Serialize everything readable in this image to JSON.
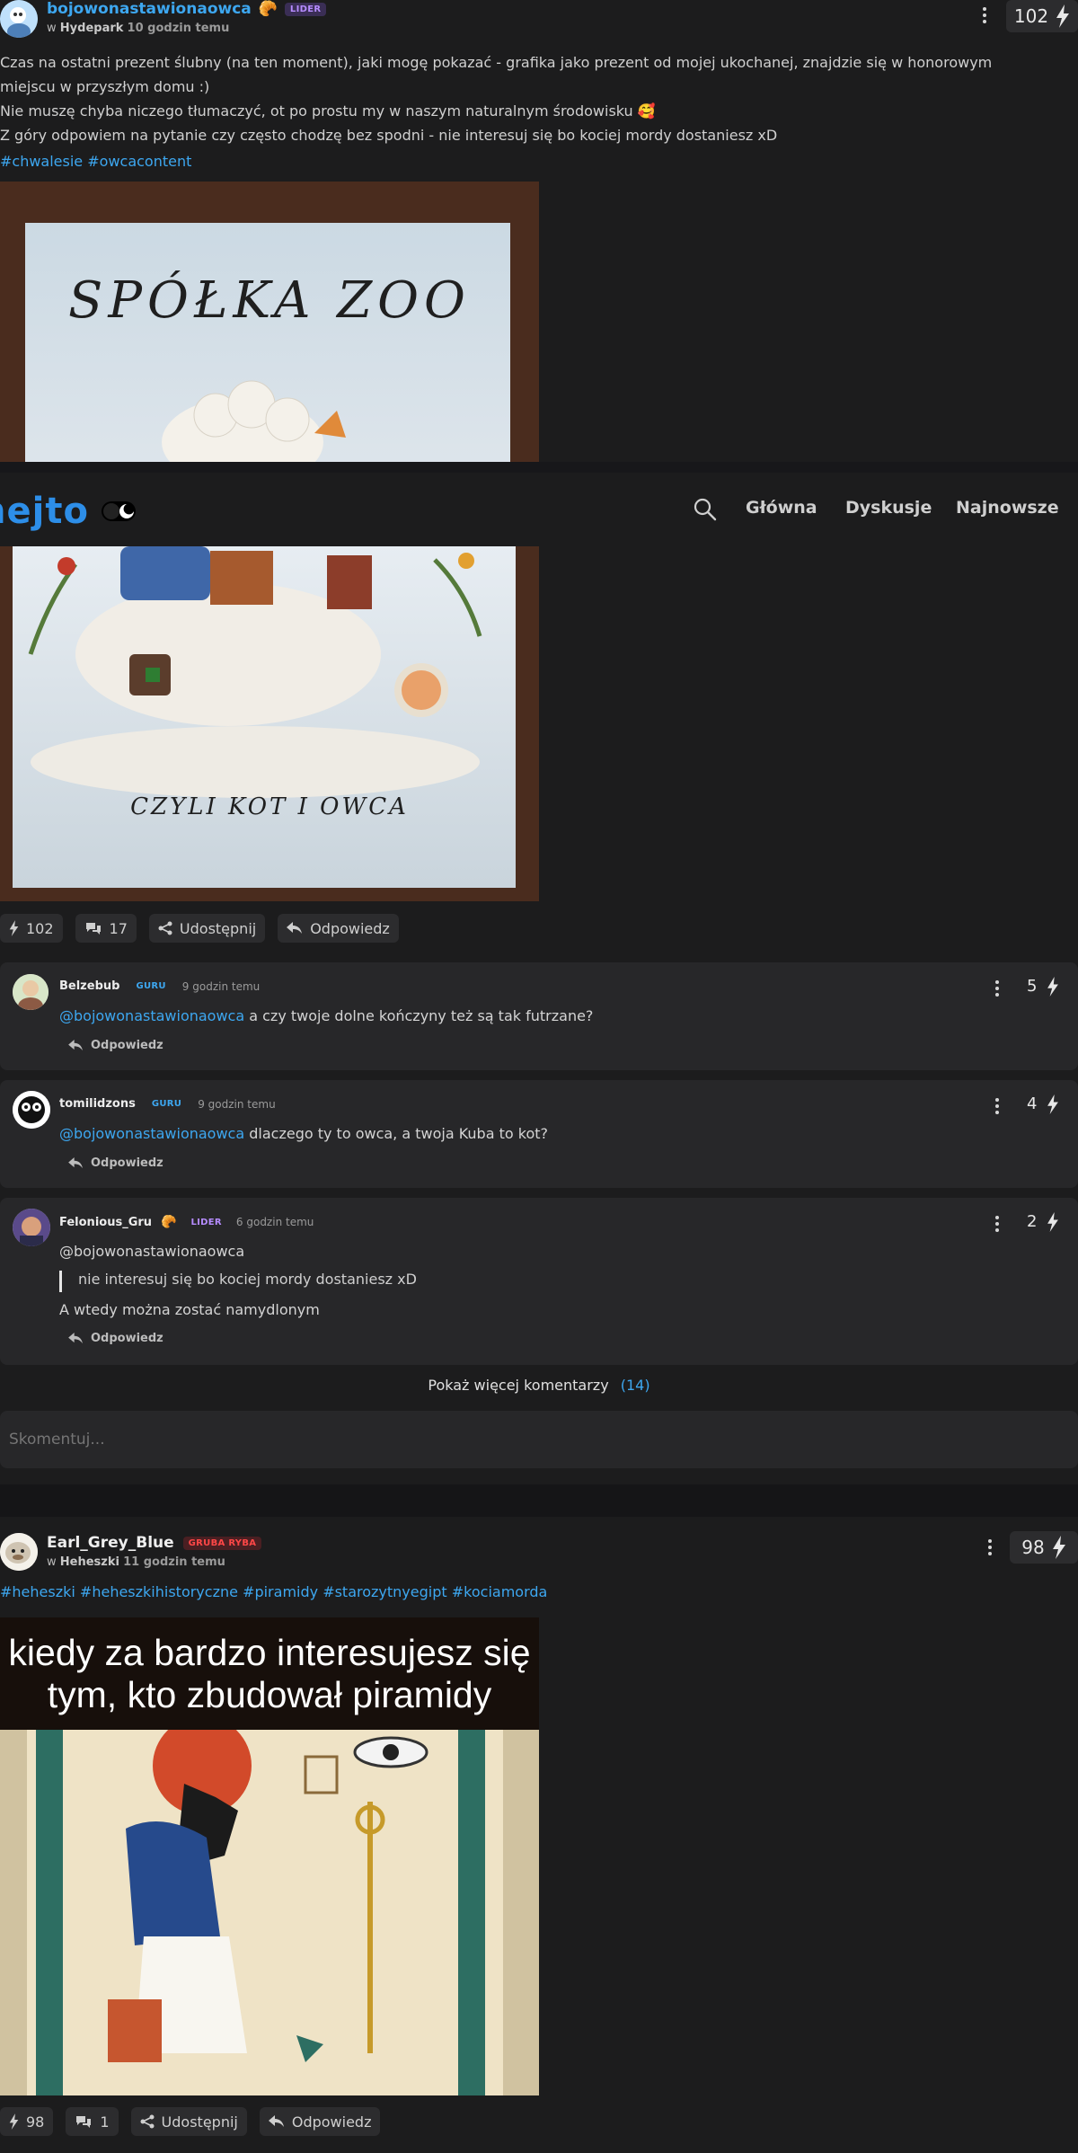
{
  "post1": {
    "author": "bojowonastawionaowca",
    "author_badge": "LIDER",
    "location_prefix": "w",
    "community": "Hydepark",
    "time": "10 godzin temu",
    "score": "102",
    "lines": [
      "Czas na ostatni prezent ślubny (na ten moment), jaki mogę pokazać - grafika jako prezent od mojej ukochanej, znajdzie się w honorowym miejscu w przyszłym domu :)",
      "Nie muszę chyba niczego tłumaczyć, ot po prostu my w naszym naturalnym środowisku 🥰",
      "Z góry odpowiem na pytanie czy często chodzę bez spodni - nie interesuj się bo kociej mordy dostaniesz xD"
    ],
    "tags": [
      "#chwalesie",
      "#owcacontent"
    ],
    "image_title": "SPÓŁKA ZOO",
    "image_subtitle": "CZYLI KOT I OWCA",
    "actions": {
      "likes": "102",
      "comments": "17",
      "share": "Udostępnij",
      "reply": "Odpowiedz"
    }
  },
  "header": {
    "logo": "hejto",
    "nav": [
      "Główna",
      "Dyskusje",
      "Najnowsze"
    ]
  },
  "comments": [
    {
      "author": "Belzebub",
      "badge": "GURU",
      "time": "9 godzin temu",
      "score": "5",
      "mention": "@bojowonastawionaowca",
      "text": " a czy twoje dolne kończyny też są tak futrzane?",
      "reply": "Odpowiedz"
    },
    {
      "author": "tomilidzons",
      "badge": "GURU",
      "time": "9 godzin temu",
      "score": "4",
      "mention": "@bojowonastawionaowca",
      "text": " dlaczego ty to owca, a twoja Kuba to kot?",
      "reply": "Odpowiedz"
    },
    {
      "author": "Felonious_Gru",
      "badge": "LIDER",
      "time": "6 godzin temu",
      "score": "2",
      "mention": "@bojowonastawionaowca",
      "quote": "nie interesuj się bo kociej mordy dostaniesz xD",
      "text": "A wtedy można zostać namydlonym",
      "reply": "Odpowiedz"
    }
  ],
  "more_comments": {
    "label": "Pokaż więcej komentarzy",
    "count": "(14)"
  },
  "comment_input": {
    "placeholder": "Skomentuj..."
  },
  "post2": {
    "author": "Earl_Grey_Blue",
    "author_badge": "GRUBA RYBA",
    "location_prefix": "w",
    "community": "Heheszki",
    "time": "11 godzin temu",
    "score": "98",
    "tags": [
      "#heheszki",
      "#heheszkihistoryczne",
      "#piramidy",
      "#starozytnyegipt",
      "#kociamorda"
    ],
    "meme_caption": "kiedy za bardzo interesujesz się tym, kto zbudował piramidy",
    "actions": {
      "likes": "98",
      "comments": "1",
      "share": "Udostępnij",
      "reply": "Odpowiedz"
    }
  },
  "colors": {
    "background": "#1c1c1d",
    "accent": "#3da7f0",
    "lider": "#b68cff",
    "ryba": "#ff4747"
  }
}
